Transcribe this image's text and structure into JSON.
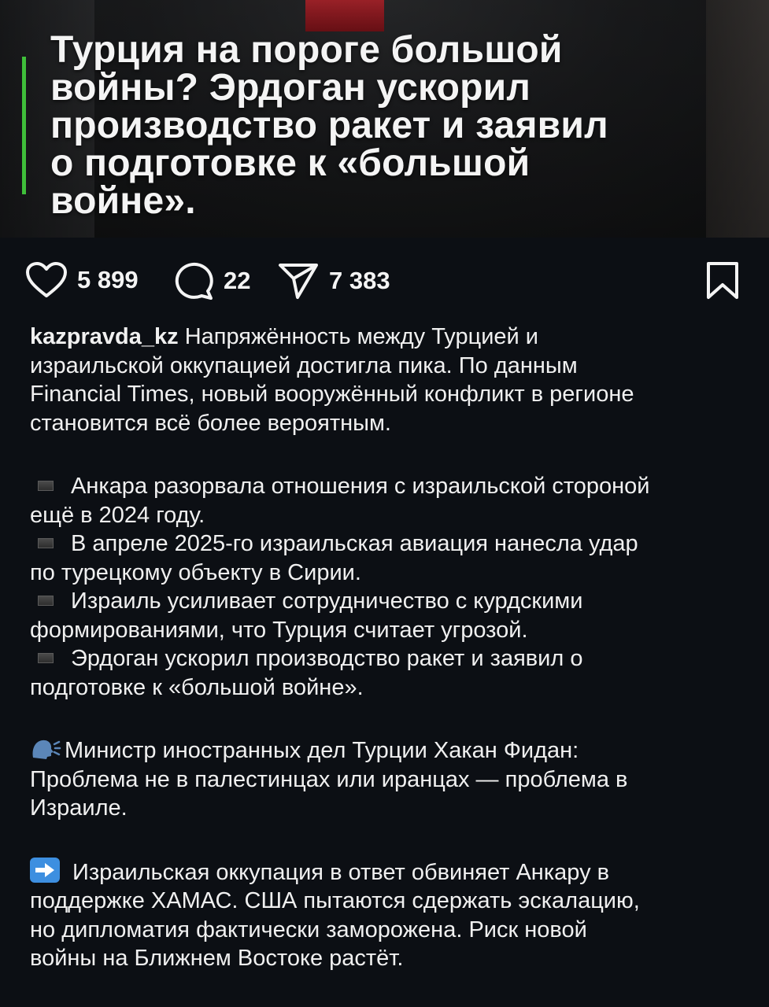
{
  "post": {
    "headline": "Турция на пороге большой войны? Эрдоган ускорил производство ракет и заявил о подготовке к «большой войне».",
    "headline_lines": [
      "Турция на пороге большой",
      "войны? Эрдоган ускорил",
      "производство ракет и заявил",
      "о подготовке к «большой",
      "войне»."
    ]
  },
  "actions": {
    "likes": "5 899",
    "comments": "22",
    "shares": "7 383",
    "icons": [
      "heart-icon",
      "comment-icon",
      "share-icon",
      "bookmark-icon"
    ]
  },
  "caption": {
    "username": "kazpravda_kz",
    "intro": "Напряжённость между Турцией и израильской оккупацией достигла пика. По данным Financial Times, новый вооружённый конфликт в регионе становится всё более вероятным.",
    "intro_lines": [
      "Напряжённость между Турцией и",
      "израильской оккупацией достигла пика. По данным",
      "Financial Times, новый вооружённый конфликт в регионе",
      "становится всё более вероятным."
    ],
    "bullets": [
      {
        "line1": "Анкара разорвала отношения с израильской стороной",
        "line2": "ещё в 2024 году."
      },
      {
        "line1": "В апреле 2025-го израильская авиация нанесла удар",
        "line2": "по турецкому объекту в Сирии."
      },
      {
        "line1": "Израиль усиливает сотрудничество с курдскими",
        "line2": "формированиями, что Турция считает угрозой."
      },
      {
        "line1": "Эрдоган ускорил производство ракет и заявил о",
        "line2": "подготовке к «большой войне»."
      }
    ],
    "quote": {
      "line1": "Министр иностранных дел Турции Хакан Фидан:",
      "line2": "Проблема не в палестинцах или иранцах — проблема в",
      "line3": "Израиле."
    },
    "closing": {
      "line1": "Израильская оккупация в ответ обвиняет Анкару в",
      "line2": "поддержке ХАМАС. США пытаются сдержать эскалацию,",
      "line3": "но дипломатия фактически заморожена. Риск новой",
      "line4": "войны на Ближнем Востоке растёт."
    }
  },
  "colors": {
    "background": "#0c0f14",
    "accent_bar": "#3fbf3a",
    "text": "#f0f0f0",
    "arrow_emoji": "#3d8fe0"
  }
}
